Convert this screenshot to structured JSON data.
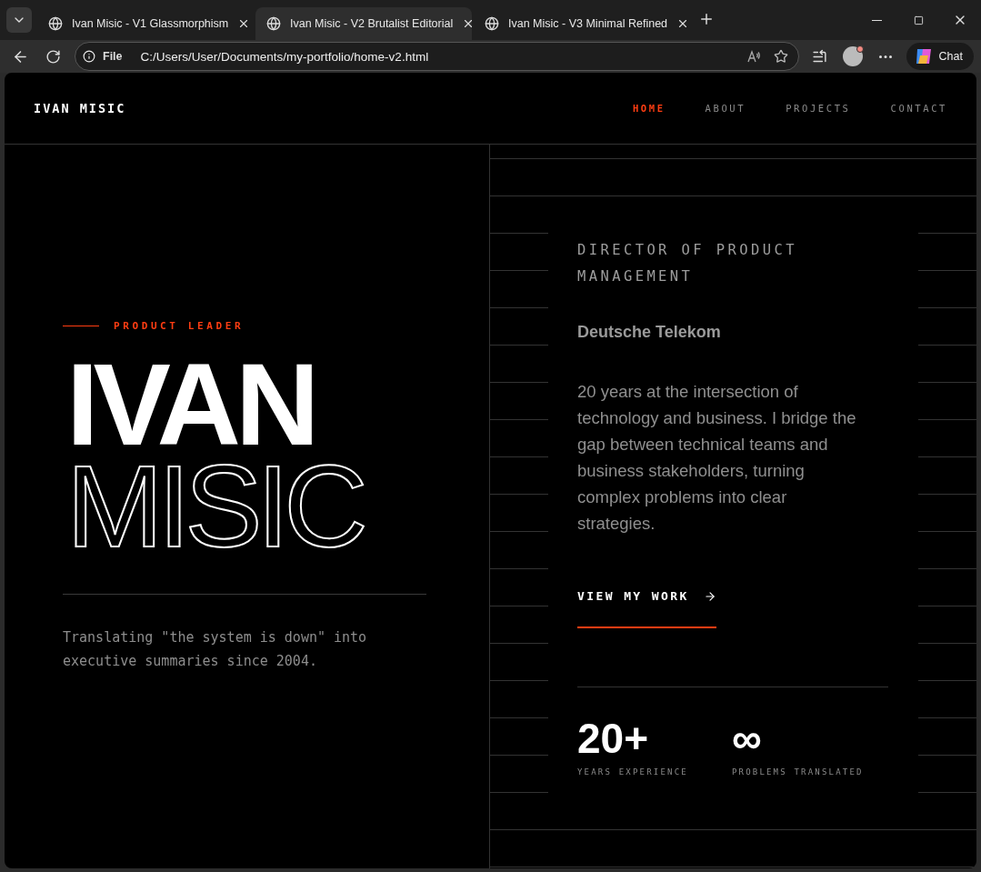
{
  "browser": {
    "tabs": [
      {
        "title": "Ivan Misic - V1 Glassmorphism",
        "selected": false
      },
      {
        "title": "Ivan Misic - V2 Brutalist Editorial",
        "selected": true
      },
      {
        "title": "Ivan Misic - V3 Minimal Refined",
        "selected": false
      }
    ],
    "address": {
      "scheme": "File",
      "url": "C:/Users/User/Documents/my-portfolio/home-v2.html"
    },
    "chat_label": "Chat"
  },
  "page": {
    "logo": "IVAN MISIC",
    "nav": [
      {
        "label": "HOME",
        "selected": true
      },
      {
        "label": "ABOUT",
        "selected": false
      },
      {
        "label": "PROJECTS",
        "selected": false
      },
      {
        "label": "CONTACT",
        "selected": false
      }
    ],
    "hero": {
      "eyebrow": "PRODUCT LEADER",
      "name_lines": [
        {
          "text": "IVAN",
          "kind": "solid"
        },
        {
          "text": "MISIC",
          "kind": "outline"
        }
      ],
      "tagline": "Translating \"the system is down\" into executive summaries since 2004."
    },
    "profile": {
      "role": "DIRECTOR OF PRODUCT MANAGEMENT",
      "company": "Deutsche Telekom",
      "bio": "20 years at the intersection of technology and business. I bridge the gap between technical teams and business stakeholders, turning complex problems into clear strategies.",
      "cta": {
        "label": "VIEW MY WORK"
      },
      "stats": [
        {
          "value": "20+",
          "label": "YEARS EXPERIENCE"
        },
        {
          "value": "∞",
          "label": "PROBLEMS TRANSLATED"
        }
      ]
    }
  }
}
